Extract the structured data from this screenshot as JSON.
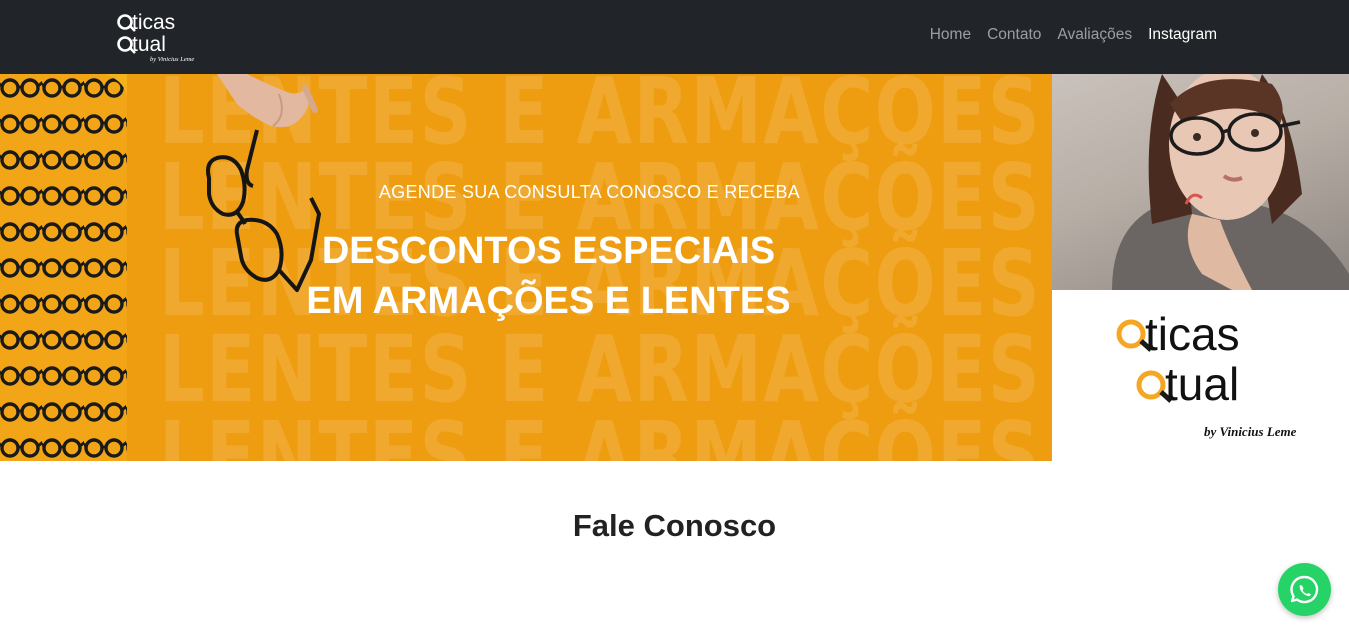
{
  "brand": {
    "name_line1": "ticas",
    "name_line2": "tual",
    "byline": "by Vinicius Leme",
    "accent_color": "#f5a623"
  },
  "nav": {
    "items": [
      {
        "label": "Home"
      },
      {
        "label": "Contato"
      },
      {
        "label": "Avaliações"
      },
      {
        "label": "Instagram"
      }
    ],
    "active": "Instagram"
  },
  "hero": {
    "background_text": "LENTES E ARMAÇÕES",
    "tagline": "AGENDE SUA CONSULTA CONOSCO E RECEBA",
    "headline_line1": "DESCONTOS ESPECIAIS",
    "headline_line2": "EM ARMAÇÕES E LENTES",
    "banner_color": "#ee9d10"
  },
  "contact": {
    "title": "Fale Conosco"
  },
  "floating": {
    "icon": "whatsapp-icon",
    "color": "#25d366"
  }
}
